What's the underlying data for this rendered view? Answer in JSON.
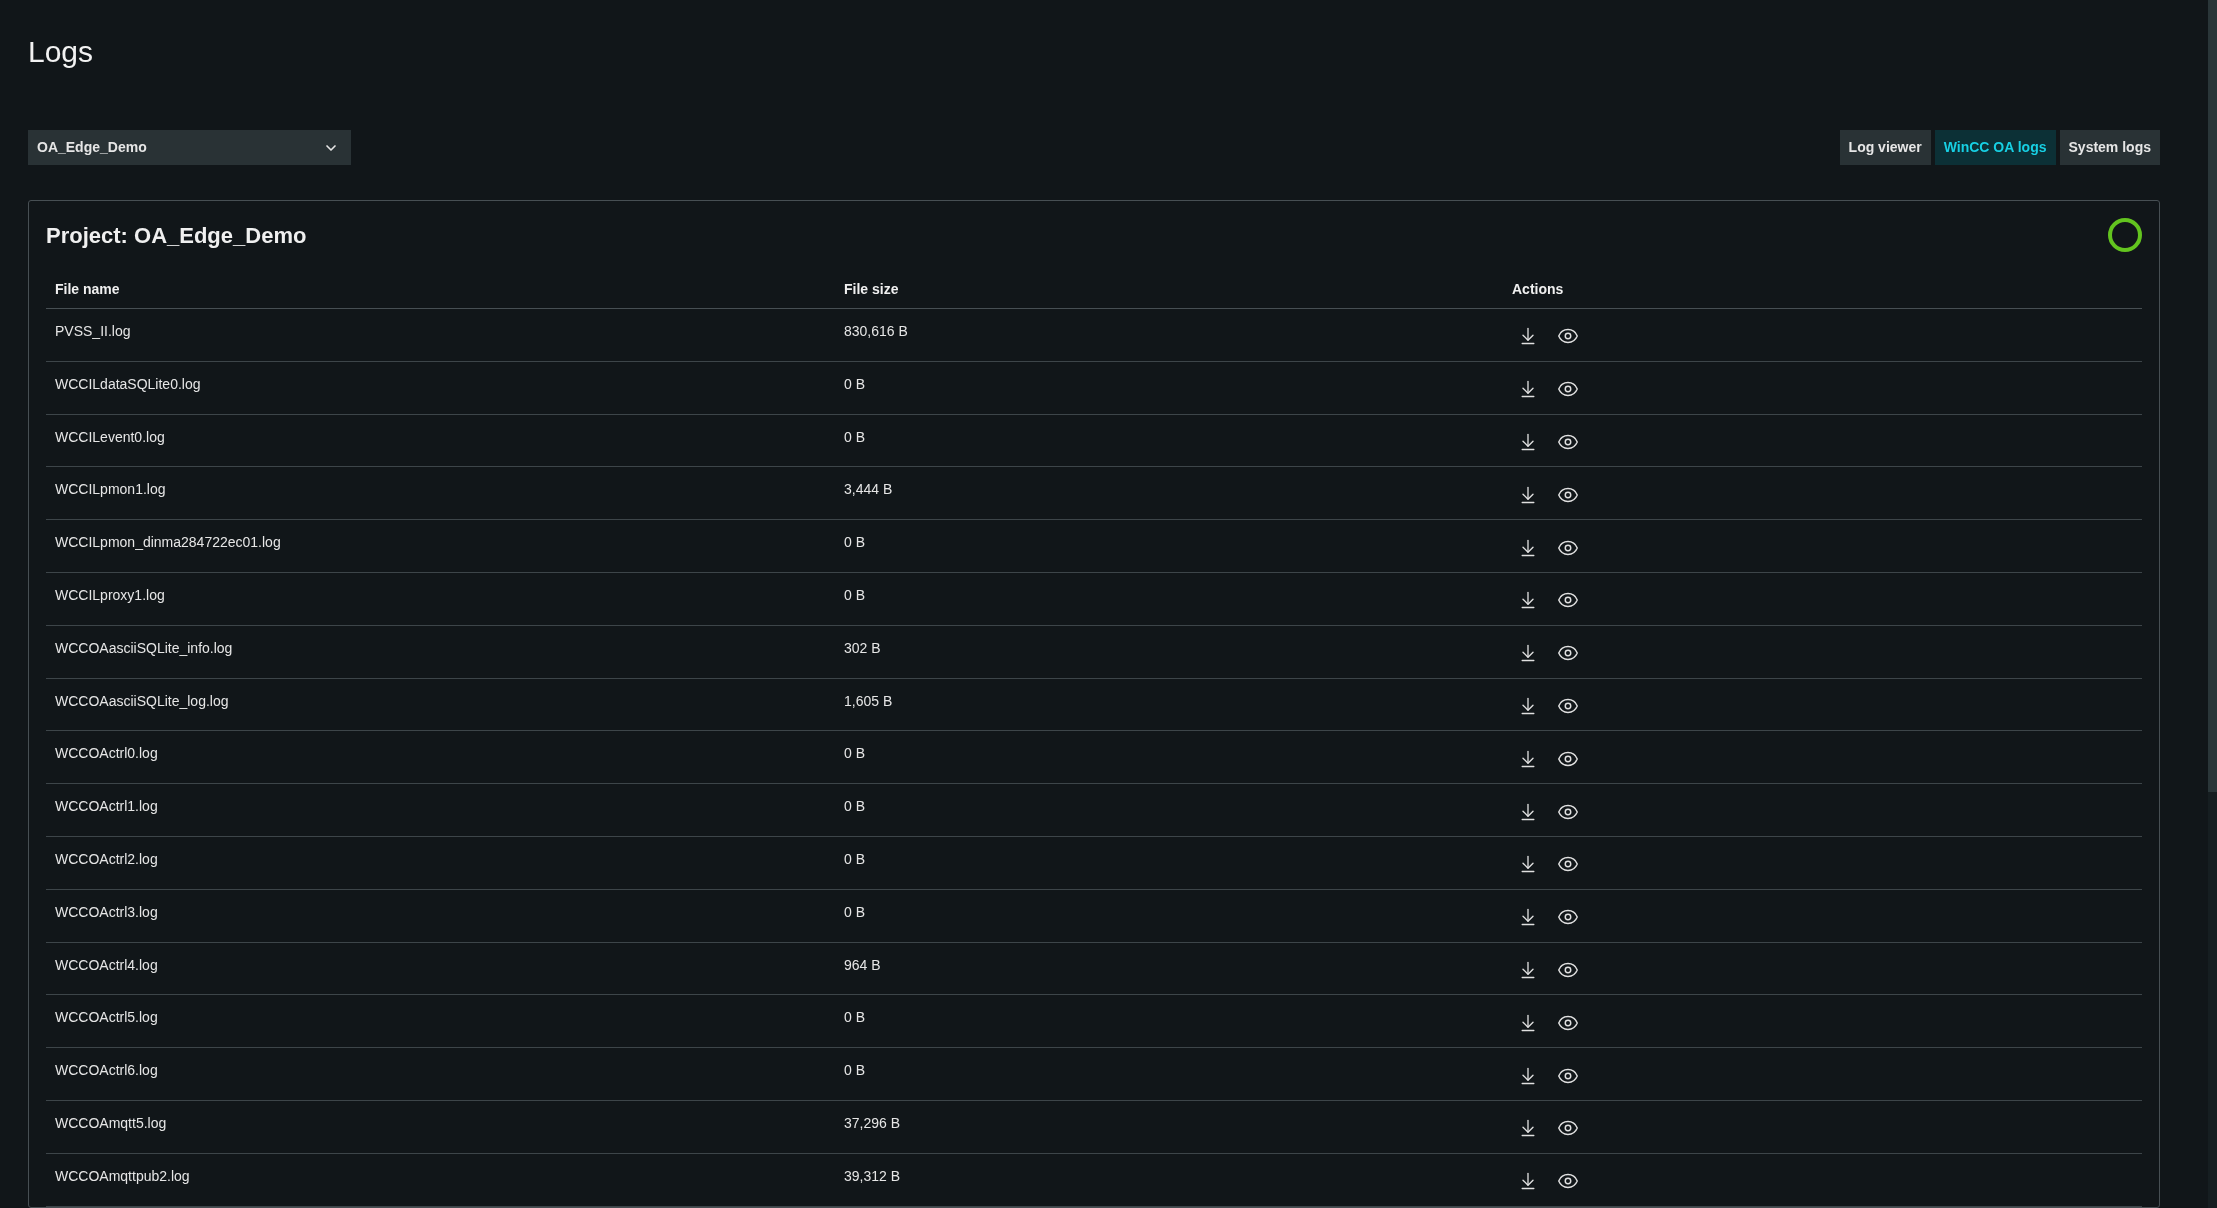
{
  "page": {
    "title": "Logs"
  },
  "project_select": {
    "value": "OA_Edge_Demo"
  },
  "view_tabs": [
    {
      "label": "Log viewer",
      "selected": false
    },
    {
      "label": "WinCC OA logs",
      "selected": true
    },
    {
      "label": "System logs",
      "selected": false
    }
  ],
  "panel": {
    "title": "Project: OA_Edge_Demo"
  },
  "table": {
    "columns": [
      "File name",
      "File size",
      "Actions"
    ],
    "rows": [
      {
        "file_name": "PVSS_II.log",
        "file_size": "830,616 B"
      },
      {
        "file_name": "WCCILdataSQLite0.log",
        "file_size": "0 B"
      },
      {
        "file_name": "WCCILevent0.log",
        "file_size": "0 B"
      },
      {
        "file_name": "WCCILpmon1.log",
        "file_size": "3,444 B"
      },
      {
        "file_name": "WCCILpmon_dinma284722ec01.log",
        "file_size": "0 B"
      },
      {
        "file_name": "WCCILproxy1.log",
        "file_size": "0 B"
      },
      {
        "file_name": "WCCOAasciiSQLite_info.log",
        "file_size": "302 B"
      },
      {
        "file_name": "WCCOAasciiSQLite_log.log",
        "file_size": "1,605 B"
      },
      {
        "file_name": "WCCOActrl0.log",
        "file_size": "0 B"
      },
      {
        "file_name": "WCCOActrl1.log",
        "file_size": "0 B"
      },
      {
        "file_name": "WCCOActrl2.log",
        "file_size": "0 B"
      },
      {
        "file_name": "WCCOActrl3.log",
        "file_size": "0 B"
      },
      {
        "file_name": "WCCOActrl4.log",
        "file_size": "964 B"
      },
      {
        "file_name": "WCCOActrl5.log",
        "file_size": "0 B"
      },
      {
        "file_name": "WCCOActrl6.log",
        "file_size": "0 B"
      },
      {
        "file_name": "WCCOAmqtt5.log",
        "file_size": "37,296 B"
      },
      {
        "file_name": "WCCOAmqttpub2.log",
        "file_size": "39,312 B"
      }
    ]
  }
}
